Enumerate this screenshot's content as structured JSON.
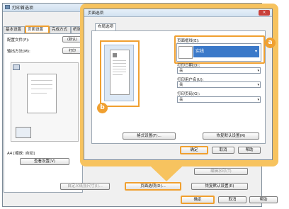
{
  "back": {
    "title": "打印首选项",
    "tabs": [
      "基本设置",
      "页面设置",
      "完成方式",
      "纸张来源"
    ],
    "profile_label": "配置文件(F):",
    "profile_value": "(默认)",
    "output_label": "输出方法(M):",
    "output_value": "打印",
    "paper_info": "A4 [缩放: 自动]",
    "view_settings_label": "查看设置(V)",
    "custom_size_label": "自定义纸张尺寸(I)...",
    "page_options_label": "页面选项(D)...",
    "restore_defaults_label": "恢复默认设置(R)",
    "edit_label": "编辑水印(T)",
    "ok_label": "确定",
    "cancel_label": "取消",
    "help_label": "帮助"
  },
  "front": {
    "title": "页面选项",
    "tab_label": "布局选项",
    "frame_label": "页面框线(E):",
    "frame_value": "实线",
    "print_date_label": "打印日期(D):",
    "print_date_value": "关",
    "print_user_label": "打印用户名(U):",
    "print_user_value": "关",
    "page_number_label": "打印页码(G):",
    "page_number_value": "关",
    "format_btn": "格式设置(F)...",
    "restore_btn": "恢复默认设置(R)",
    "ok_label": "确定",
    "cancel_label": "取消",
    "help_label": "帮助"
  },
  "badges": {
    "a": "a",
    "b": "b"
  },
  "colors": {
    "highlight": "#f0a030",
    "callout_bg": "#f7c35f",
    "selection": "#3b79c9"
  }
}
